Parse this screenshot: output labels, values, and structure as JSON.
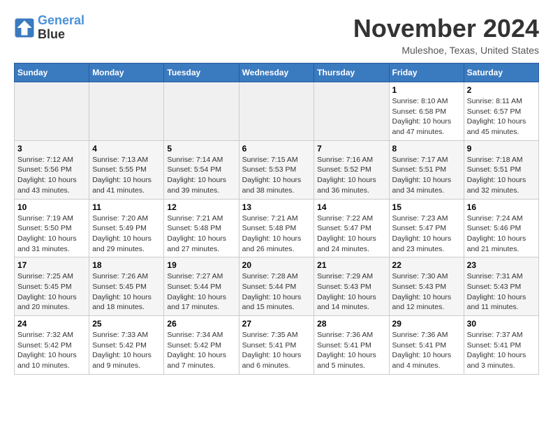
{
  "header": {
    "logo": {
      "line1": "General",
      "line2": "Blue"
    },
    "title": "November 2024",
    "location": "Muleshoe, Texas, United States"
  },
  "weekdays": [
    "Sunday",
    "Monday",
    "Tuesday",
    "Wednesday",
    "Thursday",
    "Friday",
    "Saturday"
  ],
  "weeks": [
    [
      {
        "day": "",
        "info": ""
      },
      {
        "day": "",
        "info": ""
      },
      {
        "day": "",
        "info": ""
      },
      {
        "day": "",
        "info": ""
      },
      {
        "day": "",
        "info": ""
      },
      {
        "day": "1",
        "info": "Sunrise: 8:10 AM\nSunset: 6:58 PM\nDaylight: 10 hours\nand 47 minutes."
      },
      {
        "day": "2",
        "info": "Sunrise: 8:11 AM\nSunset: 6:57 PM\nDaylight: 10 hours\nand 45 minutes."
      }
    ],
    [
      {
        "day": "3",
        "info": "Sunrise: 7:12 AM\nSunset: 5:56 PM\nDaylight: 10 hours\nand 43 minutes."
      },
      {
        "day": "4",
        "info": "Sunrise: 7:13 AM\nSunset: 5:55 PM\nDaylight: 10 hours\nand 41 minutes."
      },
      {
        "day": "5",
        "info": "Sunrise: 7:14 AM\nSunset: 5:54 PM\nDaylight: 10 hours\nand 39 minutes."
      },
      {
        "day": "6",
        "info": "Sunrise: 7:15 AM\nSunset: 5:53 PM\nDaylight: 10 hours\nand 38 minutes."
      },
      {
        "day": "7",
        "info": "Sunrise: 7:16 AM\nSunset: 5:52 PM\nDaylight: 10 hours\nand 36 minutes."
      },
      {
        "day": "8",
        "info": "Sunrise: 7:17 AM\nSunset: 5:51 PM\nDaylight: 10 hours\nand 34 minutes."
      },
      {
        "day": "9",
        "info": "Sunrise: 7:18 AM\nSunset: 5:51 PM\nDaylight: 10 hours\nand 32 minutes."
      }
    ],
    [
      {
        "day": "10",
        "info": "Sunrise: 7:19 AM\nSunset: 5:50 PM\nDaylight: 10 hours\nand 31 minutes."
      },
      {
        "day": "11",
        "info": "Sunrise: 7:20 AM\nSunset: 5:49 PM\nDaylight: 10 hours\nand 29 minutes."
      },
      {
        "day": "12",
        "info": "Sunrise: 7:21 AM\nSunset: 5:48 PM\nDaylight: 10 hours\nand 27 minutes."
      },
      {
        "day": "13",
        "info": "Sunrise: 7:21 AM\nSunset: 5:48 PM\nDaylight: 10 hours\nand 26 minutes."
      },
      {
        "day": "14",
        "info": "Sunrise: 7:22 AM\nSunset: 5:47 PM\nDaylight: 10 hours\nand 24 minutes."
      },
      {
        "day": "15",
        "info": "Sunrise: 7:23 AM\nSunset: 5:47 PM\nDaylight: 10 hours\nand 23 minutes."
      },
      {
        "day": "16",
        "info": "Sunrise: 7:24 AM\nSunset: 5:46 PM\nDaylight: 10 hours\nand 21 minutes."
      }
    ],
    [
      {
        "day": "17",
        "info": "Sunrise: 7:25 AM\nSunset: 5:45 PM\nDaylight: 10 hours\nand 20 minutes."
      },
      {
        "day": "18",
        "info": "Sunrise: 7:26 AM\nSunset: 5:45 PM\nDaylight: 10 hours\nand 18 minutes."
      },
      {
        "day": "19",
        "info": "Sunrise: 7:27 AM\nSunset: 5:44 PM\nDaylight: 10 hours\nand 17 minutes."
      },
      {
        "day": "20",
        "info": "Sunrise: 7:28 AM\nSunset: 5:44 PM\nDaylight: 10 hours\nand 15 minutes."
      },
      {
        "day": "21",
        "info": "Sunrise: 7:29 AM\nSunset: 5:43 PM\nDaylight: 10 hours\nand 14 minutes."
      },
      {
        "day": "22",
        "info": "Sunrise: 7:30 AM\nSunset: 5:43 PM\nDaylight: 10 hours\nand 12 minutes."
      },
      {
        "day": "23",
        "info": "Sunrise: 7:31 AM\nSunset: 5:43 PM\nDaylight: 10 hours\nand 11 minutes."
      }
    ],
    [
      {
        "day": "24",
        "info": "Sunrise: 7:32 AM\nSunset: 5:42 PM\nDaylight: 10 hours\nand 10 minutes."
      },
      {
        "day": "25",
        "info": "Sunrise: 7:33 AM\nSunset: 5:42 PM\nDaylight: 10 hours\nand 9 minutes."
      },
      {
        "day": "26",
        "info": "Sunrise: 7:34 AM\nSunset: 5:42 PM\nDaylight: 10 hours\nand 7 minutes."
      },
      {
        "day": "27",
        "info": "Sunrise: 7:35 AM\nSunset: 5:41 PM\nDaylight: 10 hours\nand 6 minutes."
      },
      {
        "day": "28",
        "info": "Sunrise: 7:36 AM\nSunset: 5:41 PM\nDaylight: 10 hours\nand 5 minutes."
      },
      {
        "day": "29",
        "info": "Sunrise: 7:36 AM\nSunset: 5:41 PM\nDaylight: 10 hours\nand 4 minutes."
      },
      {
        "day": "30",
        "info": "Sunrise: 7:37 AM\nSunset: 5:41 PM\nDaylight: 10 hours\nand 3 minutes."
      }
    ]
  ]
}
